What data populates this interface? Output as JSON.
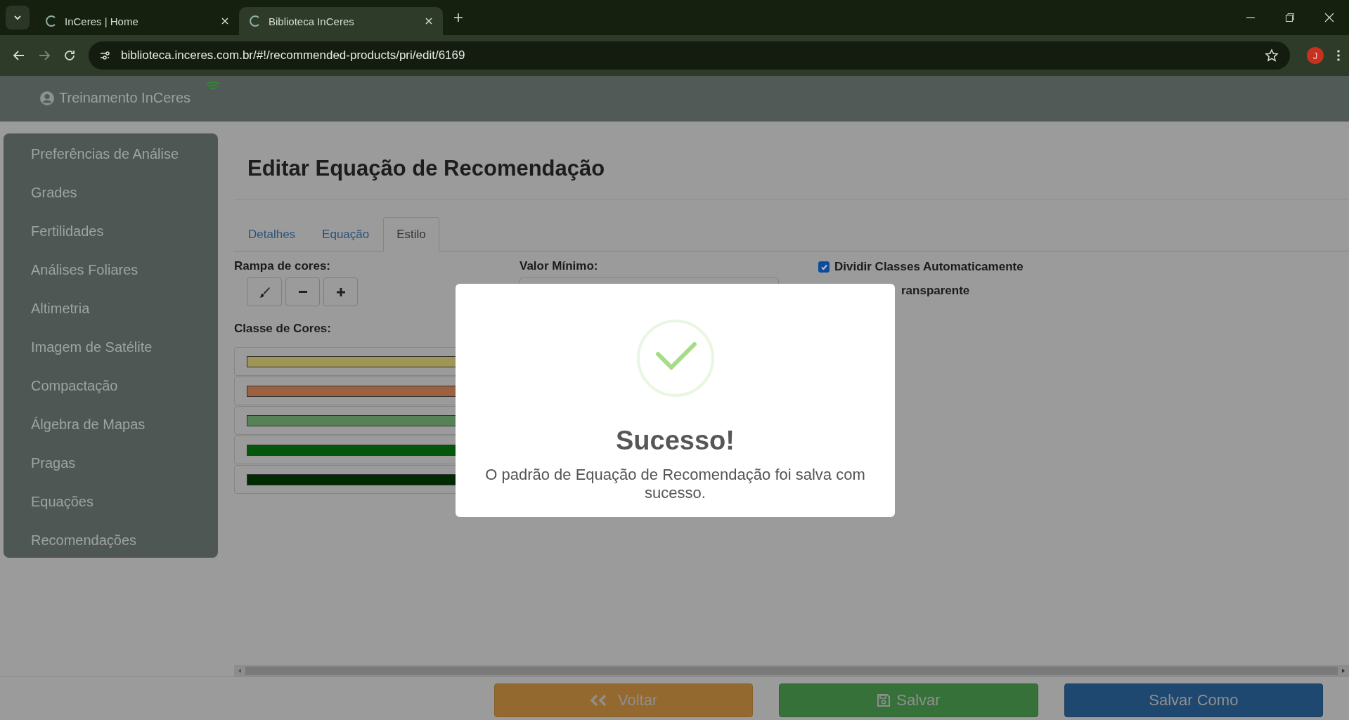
{
  "browser": {
    "tabs": [
      {
        "title": "InCeres | Home",
        "selected": false
      },
      {
        "title": "Biblioteca InCeres",
        "selected": true
      }
    ],
    "url": "biblioteca.inceres.com.br/#!/recommended-products/pri/edit/6169",
    "profile_initial": "J"
  },
  "header": {
    "user": "Treinamento InCeres"
  },
  "sidebar": {
    "items": [
      "Preferências de Análise",
      "Grades",
      "Fertilidades",
      "Análises Foliares",
      "Altimetria",
      "Imagem de Satélite",
      "Compactação",
      "Álgebra de Mapas",
      "Pragas",
      "Equações",
      "Recomendações"
    ]
  },
  "page": {
    "title": "Editar Equação de Recomendação",
    "tabs": [
      {
        "label": "Detalhes",
        "selected": false
      },
      {
        "label": "Equação",
        "selected": false
      },
      {
        "label": "Estilo",
        "selected": true
      }
    ],
    "color_ramp_label": "Rampa de cores:",
    "ramp_buttons": [
      {
        "kind": "brush"
      },
      {
        "kind": "minus"
      },
      {
        "kind": "plus"
      }
    ],
    "color_classes_label": "Classe de Cores:",
    "color_classes": [
      {
        "color": "#9e9556"
      },
      {
        "color": "#9c6140"
      },
      {
        "color": "#578157"
      },
      {
        "color": "#04570a"
      },
      {
        "color": "#002b02"
      }
    ],
    "min_value_label": "Valor Mínimo:",
    "options": [
      {
        "kind": "checkbox",
        "label": "Dividir Classes Automaticamente",
        "checked": true
      },
      {
        "kind": "text",
        "label": "ransparente"
      }
    ]
  },
  "modal": {
    "title": "Sucesso!",
    "message": "O padrão de Equação de Recomendação foi salva com sucesso."
  },
  "footer": {
    "buttons": [
      {
        "kind": "back",
        "label": "Voltar"
      },
      {
        "kind": "save",
        "label": "Salvar"
      },
      {
        "kind": "save_as",
        "label": "Salvar Como"
      }
    ]
  }
}
